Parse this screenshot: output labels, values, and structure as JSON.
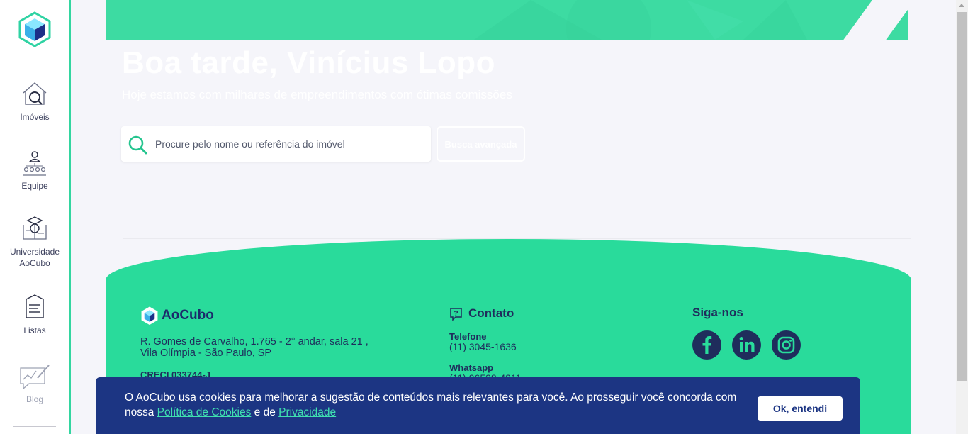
{
  "sidebar": {
    "items": [
      {
        "label": "Imóveis",
        "icon": "house-search-icon"
      },
      {
        "label": "Equipe",
        "icon": "team-icon"
      },
      {
        "label": "Universidade AoCubo",
        "icon": "graduation-book-icon"
      },
      {
        "label": "Listas",
        "icon": "list-icon"
      },
      {
        "label": "Blog",
        "icon": "blog-icon"
      }
    ]
  },
  "hero": {
    "title": "Boa tarde, Vinícius Lopo",
    "subtitle": "Hoje estamos com milhares de empreendimentos com ótimas comissões",
    "search_placeholder": "Procure pelo nome ou referência do imóvel",
    "advanced_label": "Busca avançada"
  },
  "footer": {
    "brand": "AoCubo",
    "address": "R. Gomes de Carvalho, 1.765 - 2° andar, sala 21 , Vila Olímpia - São Paulo, SP",
    "creci": "CRECI 033744-J",
    "contact_title": "Contato",
    "phone_label": "Telefone",
    "phone": "(11) 3045-1636",
    "whatsapp_label": "Whatsapp",
    "whatsapp": "(11) 96538-4311",
    "social_title": "Siga-nos",
    "social": [
      "facebook-icon",
      "linkedin-icon",
      "instagram-icon"
    ]
  },
  "cookie": {
    "text_before": "O AoCubo usa cookies para melhorar a sugestão de conteúdos mais relevantes para você. Ao prosseguir você concorda com nossa ",
    "link_cookies": "Política de Cookies",
    "text_mid": " e de ",
    "link_privacy": "Privacidade",
    "ok_label": "Ok, entendi"
  },
  "colors": {
    "accent": "#29db9b",
    "navy": "#1f2d5c",
    "cookie_bg": "#1c3583"
  }
}
